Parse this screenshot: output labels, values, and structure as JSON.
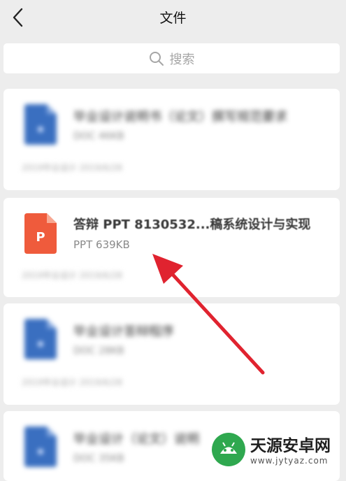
{
  "header": {
    "title": "文件"
  },
  "search": {
    "placeholder": "搜索"
  },
  "files": [
    {
      "title": "毕业设计说明书（论文）撰写规范要求",
      "meta": "DOC 46KB",
      "foot": "2019毕业设计  2019/6/28",
      "icon": "doc-file-icon",
      "blurred": true
    },
    {
      "title": "答辩 PPT 8130532...稿系统设计与实现",
      "meta": "PPT 639KB",
      "foot": "2019毕业设计  2019/6/28",
      "icon": "ppt-file-icon",
      "blurred": false,
      "icon_letter": "P"
    },
    {
      "title": "毕业设计答辩程序",
      "meta": "DOC 28KB",
      "foot": "2019毕业设计  2019/6/28",
      "icon": "doc-file-icon",
      "blurred": true
    },
    {
      "title": "毕业设计（论文）说明",
      "meta": "DOC 35KB",
      "foot": "",
      "icon": "doc-file-icon",
      "blurred": true
    }
  ],
  "watermark": {
    "name": "天源安卓网",
    "url": "www.jytyaz.com"
  },
  "colors": {
    "accent_arrow": "#e0232f",
    "ppt_orange": "#ef5b3c",
    "doc_blue": "#3a6fc0"
  }
}
